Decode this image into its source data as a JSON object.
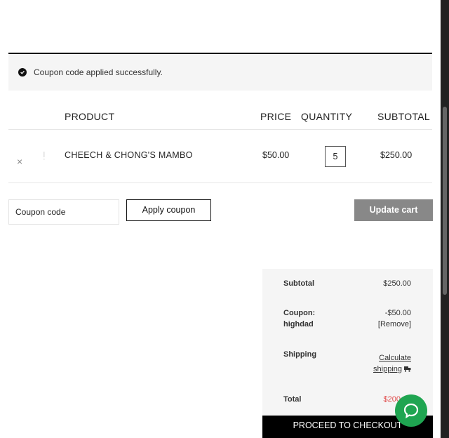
{
  "notice": {
    "message": "Coupon code applied successfully."
  },
  "table": {
    "headers": {
      "product": "PRODUCT",
      "price": "PRICE",
      "quantity": "QUANTITY",
      "subtotal": "SUBTOTAL"
    },
    "rows": [
      {
        "remove": "×",
        "product": "CHEECH & CHONG'S MAMBO",
        "price": "$50.00",
        "quantity": "5",
        "subtotal": "$250.00"
      }
    ]
  },
  "coupon": {
    "placeholder": "Coupon code",
    "apply_label": "Apply coupon"
  },
  "update_label": "Update cart",
  "totals": {
    "subtotal_label": "Subtotal",
    "subtotal_value": "$250.00",
    "coupon_label_line1": "Coupon:",
    "coupon_label_line2": "highdad",
    "coupon_value": "-$50.00",
    "coupon_remove": "[Remove]",
    "shipping_label": "Shipping",
    "shipping_link_line1": "Calculate",
    "shipping_link_line2": "shipping",
    "total_label": "Total",
    "total_value": "$200"
  },
  "checkout_label": "PROCEED TO CHECKOUT",
  "colors": {
    "accent_green": "#1fa551",
    "total_red": "#e04848",
    "update_gray": "#888888"
  }
}
